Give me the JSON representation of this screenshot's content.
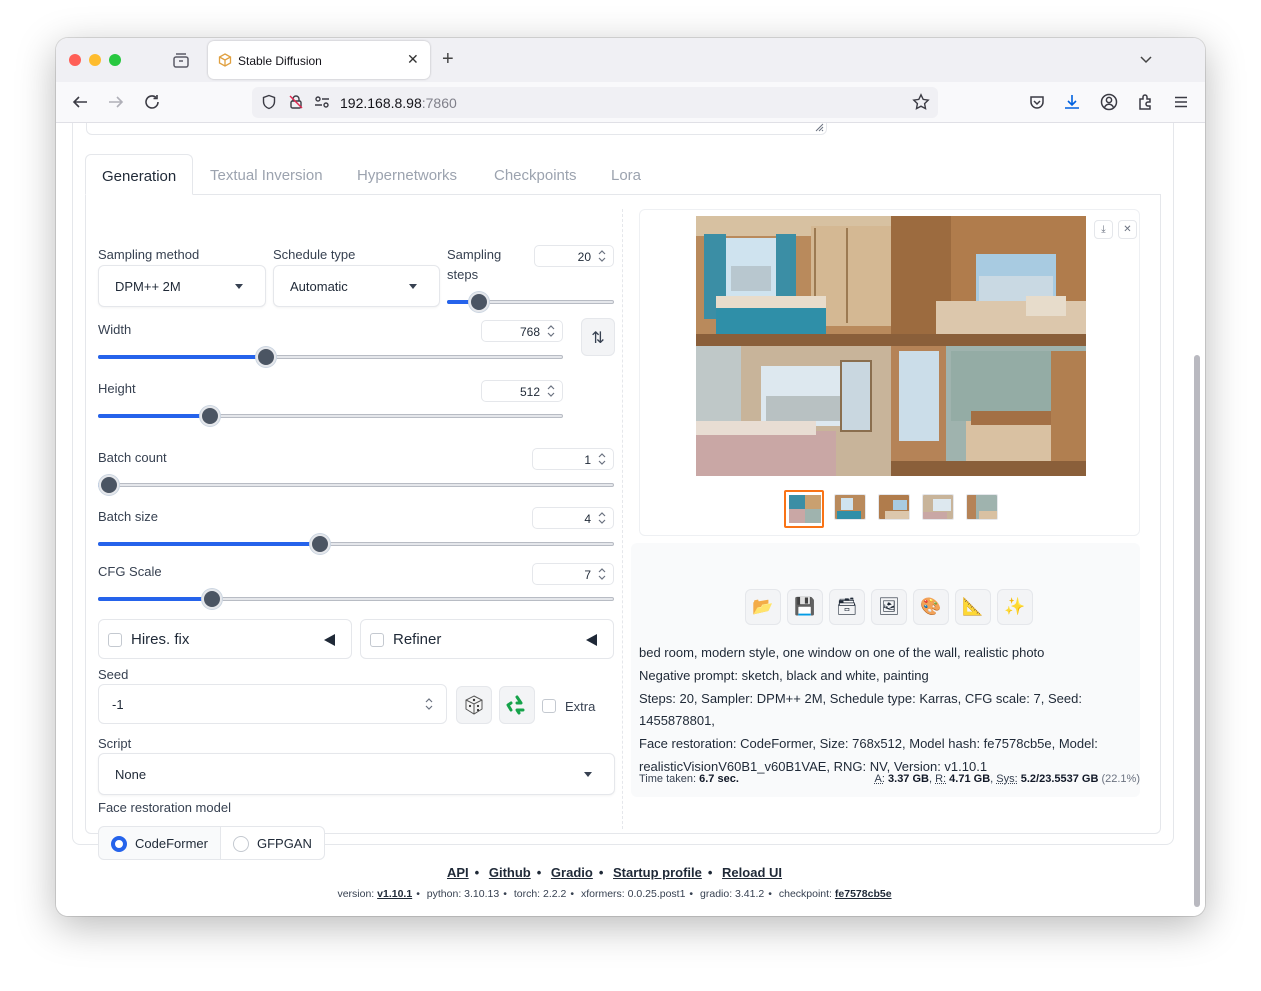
{
  "browser": {
    "tab_title": "Stable Diffusion",
    "url_host": "192.168.8.98",
    "url_port": ":7860"
  },
  "tabs": [
    {
      "label": "Generation",
      "active": true
    },
    {
      "label": "Textual Inversion",
      "active": false
    },
    {
      "label": "Hypernetworks",
      "active": false
    },
    {
      "label": "Checkpoints",
      "active": false
    },
    {
      "label": "Lora",
      "active": false
    }
  ],
  "params": {
    "sampling_method": {
      "label": "Sampling method",
      "value": "DPM++ 2M"
    },
    "schedule_type": {
      "label": "Schedule type",
      "value": "Automatic"
    },
    "sampling_steps": {
      "label_line1": "Sampling",
      "label_line2": "steps",
      "value": "20",
      "fraction": 0.19
    },
    "width": {
      "label": "Width",
      "value": "768",
      "fraction": 0.36
    },
    "height": {
      "label": "Height",
      "value": "512",
      "fraction": 0.24
    },
    "batch_count": {
      "label": "Batch count",
      "value": "1",
      "fraction": 0.0
    },
    "batch_size": {
      "label": "Batch size",
      "value": "4",
      "fraction": 0.43
    },
    "cfg_scale": {
      "label": "CFG Scale",
      "value": "7",
      "fraction": 0.22
    },
    "swap_icon": "swap-vertical-icon"
  },
  "accordions": {
    "hires": "Hires. fix",
    "refiner": "Refiner"
  },
  "seed": {
    "label": "Seed",
    "value": "-1",
    "extra_label": "Extra",
    "dice_icon": "dice-icon",
    "recycle_icon": "recycle-icon"
  },
  "script": {
    "label": "Script",
    "value": "None"
  },
  "face_restoration": {
    "label": "Face restoration model",
    "options": [
      "CodeFormer",
      "GFPGAN"
    ],
    "selected": "CodeFormer"
  },
  "gallery": {
    "thumbnail_count": 5,
    "selected_index": 0
  },
  "actions": [
    "folder-icon",
    "save-icon",
    "zip-icon",
    "image-icon",
    "palette-icon",
    "ruler-icon",
    "sparkle-icon"
  ],
  "info": {
    "prompt": "bed room, modern style, one window on one of the wall, realistic photo",
    "negative": "Negative prompt: sketch, black and white, painting",
    "line3": "Steps: 20, Sampler: DPM++ 2M, Schedule type: Karras, CFG scale: 7, Seed: 1455878801,",
    "line4": "Face restoration: CodeFormer, Size: 768x512, Model hash: fe7578cb5e, Model:",
    "line5": "realisticVisionV60B1_v60B1VAE, RNG: NV, Version: v1.10.1"
  },
  "timing": {
    "time_label": "Time taken:",
    "time_value": "6.7 sec.",
    "a_label": "A:",
    "a_value": "3.37 GB",
    "r_label": "R:",
    "r_value": "4.71 GB",
    "sys_label": "Sys:",
    "sys_value": "5.2/23.5537 GB",
    "sys_pct": "(22.1%)"
  },
  "footer": {
    "links": [
      "API",
      "Github",
      "Gradio",
      "Startup profile",
      "Reload UI"
    ],
    "version_label": "version:",
    "version_value": "v1.10.1",
    "python": "python: 3.10.13",
    "torch": "torch: 2.2.2",
    "xformers": "xformers: 0.0.25.post1",
    "gradio": "gradio: 3.41.2",
    "checkpoint_label": "checkpoint:",
    "checkpoint_value": "fe7578cb5e"
  },
  "colors": {
    "accent": "#2563eb",
    "selected_thumb": "#f97316"
  }
}
